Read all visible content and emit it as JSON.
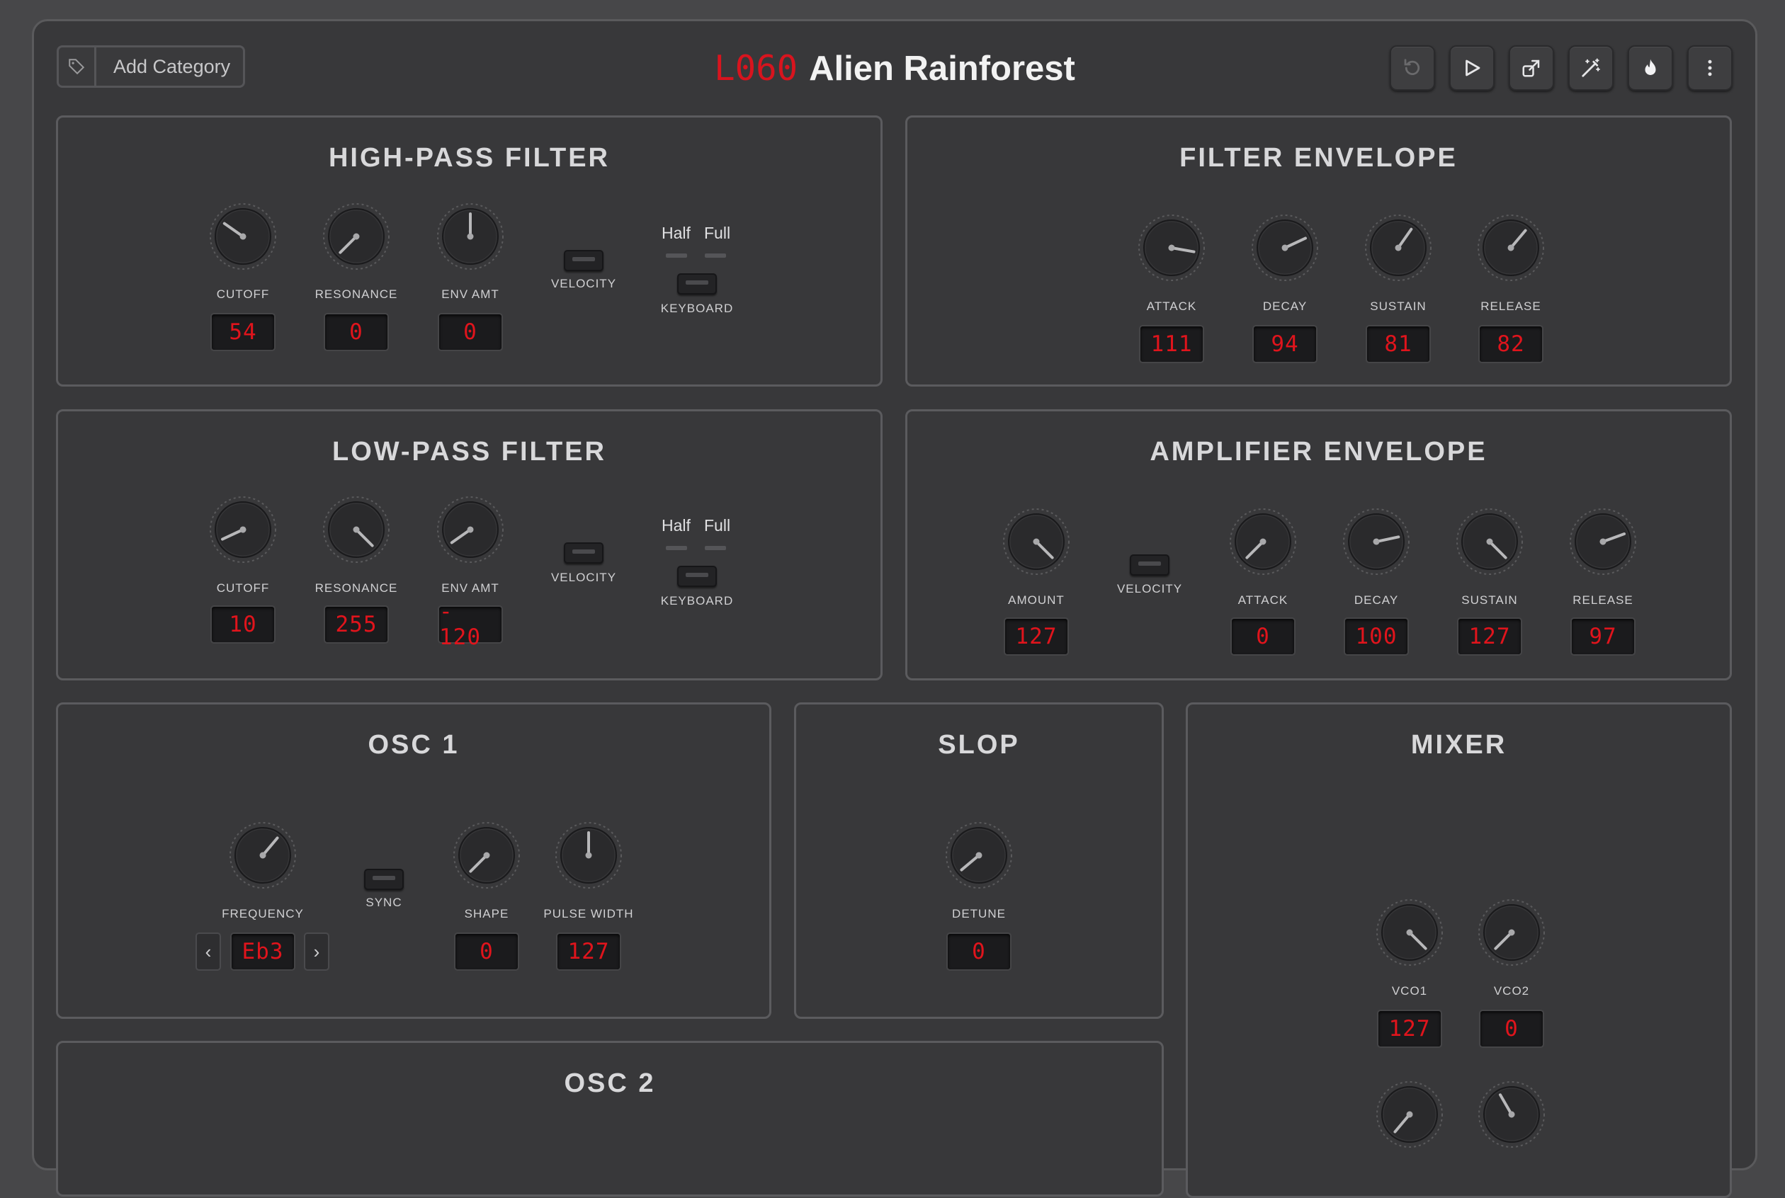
{
  "header": {
    "category_button": "Add Category",
    "preset_number": "L060",
    "preset_name": "Alien Rainforest",
    "toolbar_icons": [
      "undo-icon",
      "play-icon",
      "share-icon",
      "magic-wand-icon",
      "flame-icon",
      "more-vertical-icon"
    ]
  },
  "hpf": {
    "title": "HIGH-PASS FILTER",
    "cutoff_label": "CUTOFF",
    "cutoff_value": "54",
    "resonance_label": "RESONANCE",
    "resonance_value": "0",
    "env_amt_label": "ENV AMT",
    "env_amt_value": "0",
    "velocity_label": "VELOCITY",
    "half_label": "Half",
    "full_label": "Full",
    "keyboard_label": "KEYBOARD"
  },
  "lpf": {
    "title": "LOW-PASS FILTER",
    "cutoff_label": "CUTOFF",
    "cutoff_value": "10",
    "resonance_label": "RESONANCE",
    "resonance_value": "255",
    "env_amt_label": "ENV AMT",
    "env_amt_value": "- 120",
    "velocity_label": "VELOCITY",
    "half_label": "Half",
    "full_label": "Full",
    "keyboard_label": "KEYBOARD"
  },
  "filter_env": {
    "title": "FILTER ENVELOPE",
    "attack_label": "ATTACK",
    "attack_value": "111",
    "decay_label": "DECAY",
    "decay_value": "94",
    "sustain_label": "SUSTAIN",
    "sustain_value": "81",
    "release_label": "RELEASE",
    "release_value": "82"
  },
  "amp_env": {
    "title": "AMPLIFIER ENVELOPE",
    "amount_label": "AMOUNT",
    "amount_value": "127",
    "velocity_label": "VELOCITY",
    "attack_label": "ATTACK",
    "attack_value": "0",
    "decay_label": "DECAY",
    "decay_value": "100",
    "sustain_label": "SUSTAIN",
    "sustain_value": "127",
    "release_label": "RELEASE",
    "release_value": "97"
  },
  "osc1": {
    "title": "OSC 1",
    "frequency_label": "FREQUENCY",
    "frequency_value": "Eb3",
    "prev_symbol": "‹",
    "next_symbol": "›",
    "sync_label": "SYNC",
    "shape_label": "SHAPE",
    "shape_value": "0",
    "pulse_width_label": "PULSE WIDTH",
    "pulse_width_value": "127"
  },
  "slop": {
    "title": "SLOP",
    "detune_label": "DETUNE",
    "detune_value": "0"
  },
  "mixer": {
    "title": "MIXER",
    "vco1_label": "VCO1",
    "vco1_value": "127",
    "vco2_label": "VCO2",
    "vco2_value": "0"
  },
  "osc2": {
    "title": "OSC 2"
  }
}
